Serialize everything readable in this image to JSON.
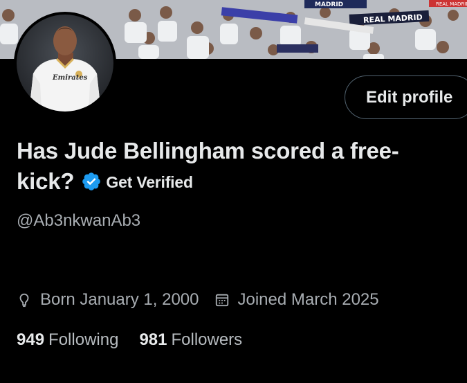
{
  "header": {
    "banner_text": [
      "MADRID",
      "REAL MADRID",
      "REAL MADRID"
    ],
    "avatar_shirt_text": "Emirates"
  },
  "actions": {
    "edit_profile_label": "Edit profile"
  },
  "profile": {
    "display_name": "Has Jude Bellingham scored a free-kick?",
    "verify_label": "Get Verified",
    "handle": "@Ab3nkwanAb3",
    "born": "Born January 1, 2000",
    "joined": "Joined March 2025"
  },
  "stats": {
    "following_count": "949",
    "following_label": "Following",
    "followers_count": "981",
    "followers_label": "Followers"
  },
  "colors": {
    "background": "#000000",
    "text_primary": "#e7e9ea",
    "text_secondary": "#a8adb2",
    "button_border": "#536471",
    "verified_badge": "#1d9bf0"
  },
  "icons": [
    "location-icon",
    "calendar-icon",
    "verified-badge-icon"
  ]
}
